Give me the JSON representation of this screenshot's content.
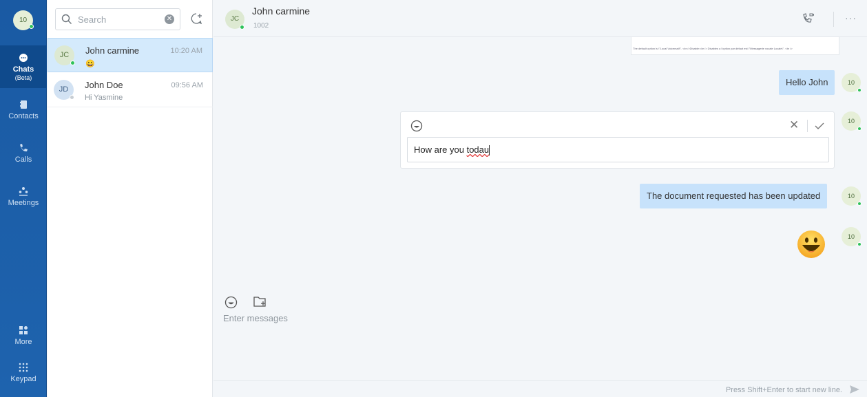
{
  "nav": {
    "my_initials": "10",
    "items": [
      {
        "label": "Chats",
        "sub": "(Beta)"
      },
      {
        "label": "Contacts"
      },
      {
        "label": "Calls"
      },
      {
        "label": "Meetings"
      },
      {
        "label": "More"
      },
      {
        "label": "Keypad"
      }
    ]
  },
  "list": {
    "search_placeholder": "Search",
    "conversations": [
      {
        "initials": "JC",
        "name": "John carmine",
        "time": "10:20 AM",
        "preview": "😀",
        "status": "online"
      },
      {
        "initials": "JD",
        "name": "John Doe",
        "time": "09:56 AM",
        "preview": "Hi Yasmine",
        "status": "offline"
      }
    ]
  },
  "chat": {
    "contact_initials": "JC",
    "contact_name": "John carmine",
    "contact_ext": "1002",
    "doc_preview_text": "The default option is \\\"Local Voicemail\\\". <br />Disable:<br /> Disables a l'option par défaut est \\\"Messagerie vocale Locale\\\". <br />",
    "messages": [
      {
        "text": "Hello John"
      },
      {
        "text": "The document requested has been updated"
      }
    ],
    "my_avatar": "10",
    "editing": {
      "text_before": "How are you ",
      "typo_word": "todau"
    },
    "composer_placeholder": "Enter messages",
    "footer_hint": "Press Shift+Enter to start new line.",
    "colors": {
      "accent": "#1e63ae",
      "bubble": "#c7e2fb",
      "online": "#2ec25a"
    }
  }
}
